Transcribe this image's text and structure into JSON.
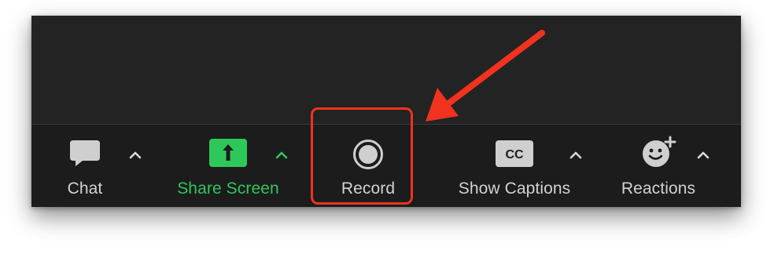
{
  "toolbar": {
    "chat": {
      "label": "Chat",
      "icon": "chat-bubble-icon"
    },
    "share_screen": {
      "label": "Share Screen",
      "icon": "share-screen-icon",
      "color": "#2ec85a"
    },
    "record": {
      "label": "Record",
      "icon": "record-icon"
    },
    "show_captions": {
      "label": "Show Captions",
      "icon": "cc-icon",
      "icon_text": "CC"
    },
    "reactions": {
      "label": "Reactions",
      "icon": "reactions-icon"
    }
  },
  "annotation": {
    "highlight_color": "#f0321e",
    "target": "record"
  },
  "colors": {
    "window_bg": "#232323",
    "toolbar_bg": "#1c1c1c",
    "label": "#d2d2d2",
    "accent_green": "#2ec85a"
  }
}
